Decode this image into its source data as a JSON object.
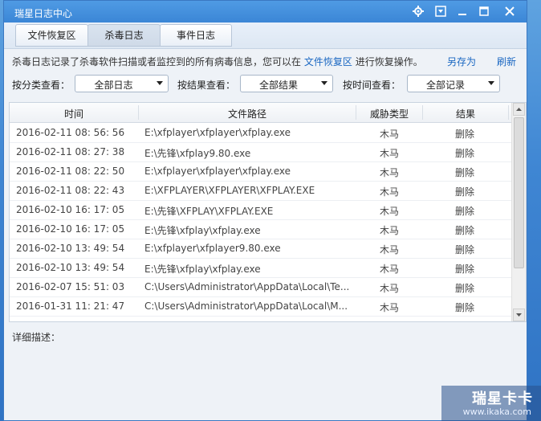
{
  "window": {
    "title": "瑞星日志中心"
  },
  "title_buttons": [
    "settings-icon",
    "menu-icon",
    "minimize-icon",
    "maximize-icon",
    "close-icon"
  ],
  "tabs": [
    {
      "label": "文件恢复区",
      "active": false
    },
    {
      "label": "杀毒日志",
      "active": true
    },
    {
      "label": "事件日志",
      "active": false
    }
  ],
  "info": {
    "text_before": "杀毒日志记录了杀毒软件扫描或者监控到的所有病毒信息，您可以在",
    "link": "文件恢复区",
    "text_after": "进行恢复操作。",
    "save_as": "另存为",
    "refresh": "刷新"
  },
  "filters": {
    "category_label": "按分类查看：",
    "category_value": "全部日志",
    "result_label": "按结果查看：",
    "result_value": "全部结果",
    "time_label": "按时间查看：",
    "time_value": "全部记录"
  },
  "table": {
    "headers": {
      "time": "时间",
      "path": "文件路径",
      "threat": "威胁类型",
      "result": "结果"
    },
    "rows": [
      {
        "time": "2016-02-11 08: 56: 56",
        "path": "E:\\xfplayer\\xfplayer\\xfplay.exe",
        "threat": "木马",
        "result": "删除"
      },
      {
        "time": "2016-02-11 08: 27: 38",
        "path": "E:\\先锋\\xfplay9.80.exe",
        "threat": "木马",
        "result": "删除"
      },
      {
        "time": "2016-02-11 08: 22: 50",
        "path": "E:\\xfplayer\\xfplayer\\xfplay.exe",
        "threat": "木马",
        "result": "删除"
      },
      {
        "time": "2016-02-11 08: 22: 43",
        "path": "E:\\XFPLAYER\\XFPLAYER\\XFPLAY.EXE",
        "threat": "木马",
        "result": "删除"
      },
      {
        "time": "2016-02-10 16: 17: 05",
        "path": "E:\\先锋\\XFPLAY\\XFPLAY.EXE",
        "threat": "木马",
        "result": "删除"
      },
      {
        "time": "2016-02-10 16: 17: 05",
        "path": "E:\\先锋\\xfplay\\xfplay.exe",
        "threat": "木马",
        "result": "删除"
      },
      {
        "time": "2016-02-10 13: 49: 54",
        "path": "E:\\xfplayer\\xfplayer9.80.exe",
        "threat": "木马",
        "result": "删除"
      },
      {
        "time": "2016-02-10 13: 49: 54",
        "path": "E:\\先锋\\xfplay\\xfplay.exe",
        "threat": "木马",
        "result": "删除"
      },
      {
        "time": "2016-02-07 15: 51: 03",
        "path": "C:\\Users\\Administrator\\AppData\\Local\\Te...",
        "threat": "木马",
        "result": "删除"
      },
      {
        "time": "2016-01-31 11: 21: 47",
        "path": "C:\\Users\\Administrator\\AppData\\Local\\M...",
        "threat": "木马",
        "result": "删除"
      }
    ]
  },
  "detail": {
    "label": "详细描述："
  },
  "watermark": {
    "main": "瑞星卡卡",
    "url": "www.ikaka.com"
  }
}
